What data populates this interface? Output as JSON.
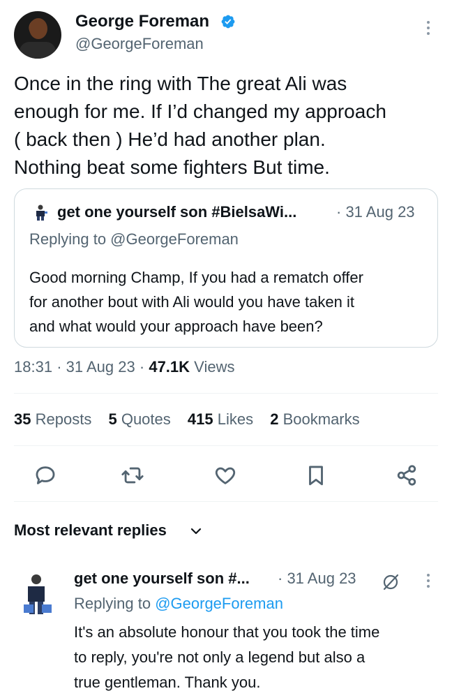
{
  "tweet": {
    "author_name": "George Foreman",
    "author_handle": "@GeorgeForeman",
    "body_lines": [
      "Once in the ring with The great Ali was",
      "enough for me. If I’d changed my approach",
      "( back then ) He’d had another plan.",
      "Nothing beat some fighters But time."
    ],
    "time": "18:31",
    "date": "31 Aug 23",
    "views_count": "47.1K",
    "views_label": "Views"
  },
  "quoted": {
    "author_name": "get one yourself son #BielsaWi...",
    "date": "· 31 Aug 23",
    "replying_to": "Replying to @GeorgeForeman",
    "body_lines": [
      "Good morning Champ, If you had a rematch offer",
      "for another bout with Ali would you have taken it",
      "and what would your approach have been?"
    ]
  },
  "stats": [
    {
      "count": "35",
      "label": "Reposts"
    },
    {
      "count": "5",
      "label": "Quotes"
    },
    {
      "count": "415",
      "label": "Likes"
    },
    {
      "count": "2",
      "label": "Bookmarks"
    }
  ],
  "actions": [
    "reply-icon",
    "repost-icon",
    "like-icon",
    "bookmark-icon",
    "share-icon"
  ],
  "replies_sort": {
    "label": "Most relevant replies"
  },
  "reply": {
    "author_name": "get one yourself son #...",
    "date": "· 31 Aug 23",
    "replying_prefix": "Replying to",
    "replying_handle": "@GeorgeForeman",
    "body_lines": [
      "It's an absolute honour that you took the time",
      "to reply, you're not only a legend but also a",
      "true gentleman. Thank you."
    ]
  },
  "colors": {
    "text": "#0f1419",
    "secondary": "#536471",
    "link": "#1d9bf0",
    "verified": "#1d9bf0",
    "border": "#cfd9de"
  }
}
